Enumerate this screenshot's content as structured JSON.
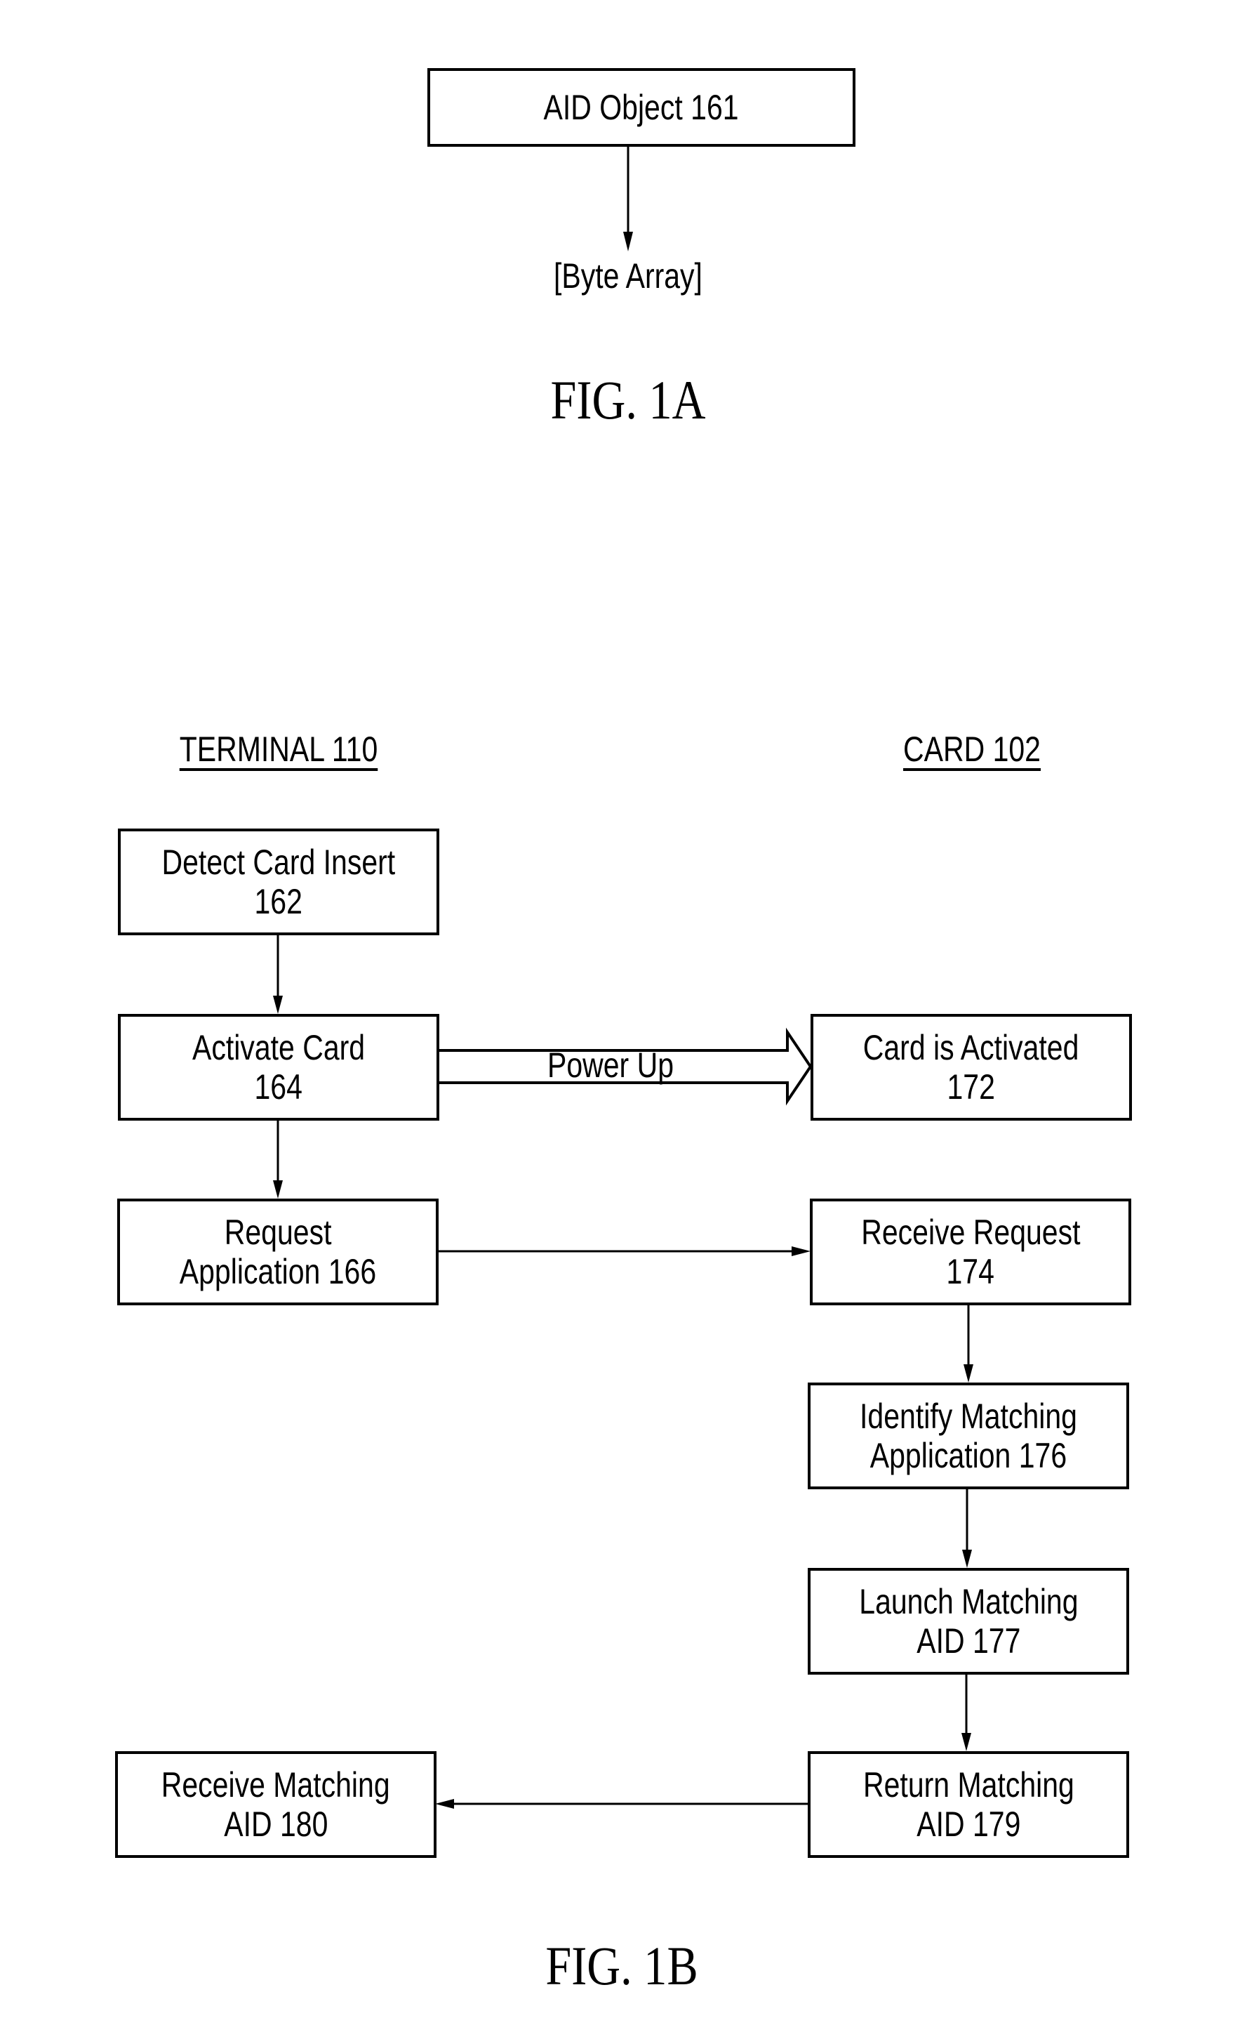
{
  "figure_1a": {
    "caption": "FIG. 1A",
    "object_box": "AID Object 161",
    "output_label": "[Byte Array]"
  },
  "figure_1b": {
    "caption": "FIG. 1B",
    "terminal_heading": "TERMINAL 110",
    "card_heading": "CARD 102",
    "terminal_steps": [
      {
        "line1": "Detect Card Insert",
        "line2": "162"
      },
      {
        "line1": "Activate Card",
        "line2": "164"
      },
      {
        "line1": "Request",
        "line2": "Application 166"
      },
      {
        "line1": "Receive Matching",
        "line2": "AID 180"
      }
    ],
    "card_steps": [
      {
        "line1": "Card is Activated",
        "line2": "172"
      },
      {
        "line1": "Receive Request",
        "line2": "174"
      },
      {
        "line1": "Identify Matching",
        "line2": "Application 176"
      },
      {
        "line1": "Launch Matching",
        "line2": "AID 177"
      },
      {
        "line1": "Return Matching",
        "line2": "AID 179"
      }
    ],
    "power_label": "Power Up"
  }
}
